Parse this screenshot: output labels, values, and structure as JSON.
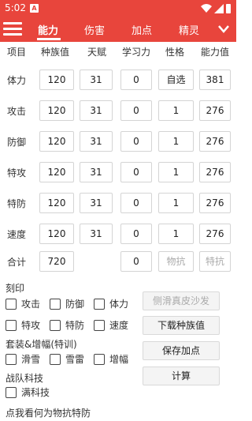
{
  "status": {
    "time": "5:02",
    "notif_letter": "A"
  },
  "tabs": [
    {
      "label": "能力",
      "active": true
    },
    {
      "label": "伤害",
      "active": false
    },
    {
      "label": "加点",
      "active": false
    },
    {
      "label": "精灵",
      "active": false
    }
  ],
  "headers": [
    "项目",
    "种族值",
    "天赋",
    "学习力",
    "性格",
    "能力值"
  ],
  "stats": [
    {
      "label": "体力",
      "race": "120",
      "talent": "31",
      "effort": "0",
      "nature": "自选",
      "value": "381"
    },
    {
      "label": "攻击",
      "race": "120",
      "talent": "31",
      "effort": "0",
      "nature": "1",
      "value": "276"
    },
    {
      "label": "防御",
      "race": "120",
      "talent": "31",
      "effort": "0",
      "nature": "1",
      "value": "276"
    },
    {
      "label": "特攻",
      "race": "120",
      "talent": "31",
      "effort": "0",
      "nature": "1",
      "value": "276"
    },
    {
      "label": "特防",
      "race": "120",
      "talent": "31",
      "effort": "0",
      "nature": "1",
      "value": "276"
    },
    {
      "label": "速度",
      "race": "120",
      "talent": "31",
      "effort": "0",
      "nature": "1",
      "value": "276"
    }
  ],
  "total": {
    "label": "合计",
    "race": "720",
    "effort": "0",
    "physical_placeholder": "物抗",
    "special_placeholder": "特抗"
  },
  "engrave": {
    "title": "刻印",
    "items": [
      "攻击",
      "防御",
      "体力",
      "特攻",
      "特防",
      "速度"
    ]
  },
  "suit": {
    "title": "套装&增幅(特训)",
    "items": [
      "滑雪",
      "雪雷",
      "增幅"
    ]
  },
  "team": {
    "title": "战队科技",
    "items": [
      "满科技"
    ]
  },
  "buttons": {
    "paste": "侧滑真皮沙发",
    "download": "下载种族值",
    "save": "保存加点",
    "calc": "计算"
  },
  "footer": "点我看何为物抗特防",
  "colors": {
    "primary": "#e8453c"
  }
}
